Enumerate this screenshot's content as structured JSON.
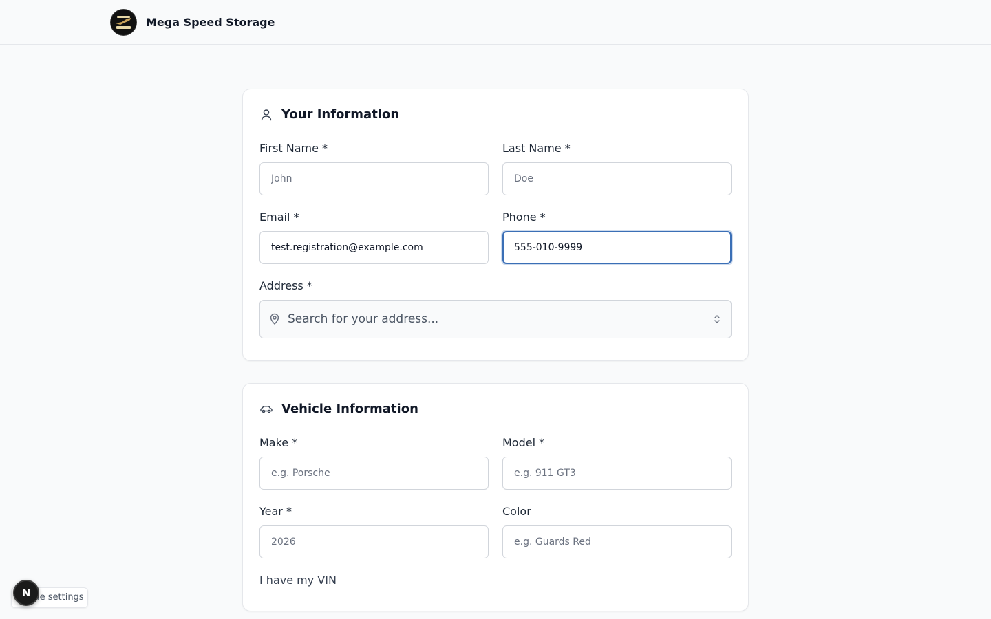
{
  "header": {
    "brand_name": "Mega Speed Storage",
    "logo_icon": "brand-logo-icon"
  },
  "your_info": {
    "title": "Your Information",
    "icon": "user-icon",
    "first_name": {
      "label": "First Name *",
      "value": "",
      "placeholder": "John"
    },
    "last_name": {
      "label": "Last Name *",
      "value": "",
      "placeholder": "Doe"
    },
    "email": {
      "label": "Email *",
      "value": "test.registration@example.com",
      "placeholder": ""
    },
    "phone": {
      "label": "Phone *",
      "value": "555-010-9999",
      "placeholder": ""
    },
    "address": {
      "label": "Address *",
      "placeholder": "Search for your address...",
      "icon": "map-pin-icon"
    }
  },
  "vehicle_info": {
    "title": "Vehicle Information",
    "icon": "car-icon",
    "make": {
      "label": "Make *",
      "value": "",
      "placeholder": "e.g. Porsche"
    },
    "model": {
      "label": "Model *",
      "value": "",
      "placeholder": "e.g. 911 GT3"
    },
    "year": {
      "label": "Year *",
      "value": "",
      "placeholder": "2026"
    },
    "color": {
      "label": "Color",
      "value": "",
      "placeholder": "e.g. Guards Red"
    },
    "vin_link": "I have my VIN"
  },
  "overlay": {
    "cookie_label": "ie settings",
    "badge_letter": "N"
  },
  "colors": {
    "focus_ring": "#3b6fb6",
    "border": "#d1d5db",
    "page_bg": "#f9fafb"
  }
}
